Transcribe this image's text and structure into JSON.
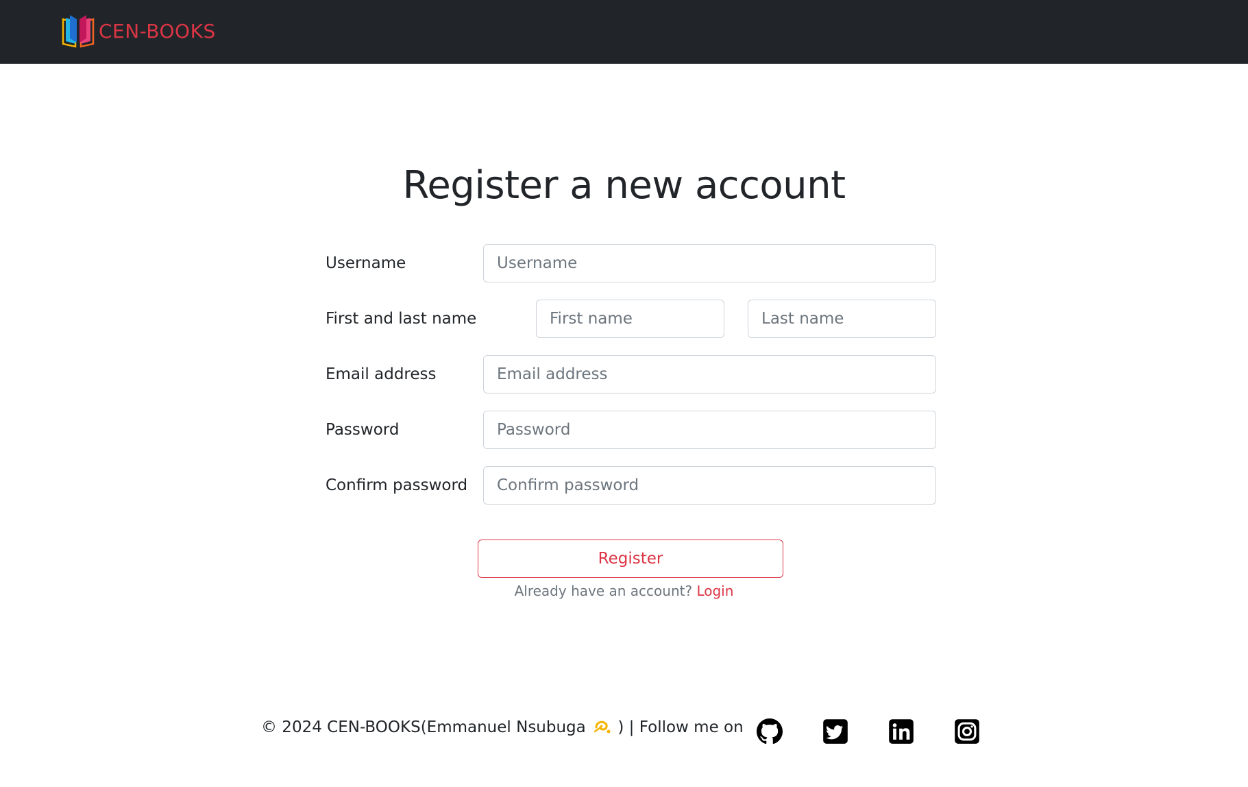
{
  "navbar": {
    "brand": "CEN-BOOKS"
  },
  "page": {
    "title": "Register a new account"
  },
  "form": {
    "username": {
      "label": "Username",
      "placeholder": "Username",
      "value": ""
    },
    "name": {
      "label": "First and last name",
      "first_placeholder": "First name",
      "last_placeholder": "Last name"
    },
    "email": {
      "label": "Email address",
      "placeholder": "Email address"
    },
    "password": {
      "label": "Password",
      "placeholder": "Password"
    },
    "confirm": {
      "label": "Confirm password",
      "placeholder": "Confirm password"
    },
    "submit_label": "Register",
    "login_prompt": "Already have an account?",
    "login_link": "Login"
  },
  "footer": {
    "text_before": "© 2024 CEN-BOOKS(Emmanuel Nsubuga",
    "text_after": ") | Follow me on",
    "social": [
      "github-icon",
      "twitter-icon",
      "linkedin-icon",
      "instagram-icon"
    ]
  },
  "colors": {
    "navbar_bg": "#212529",
    "accent": "#dc3545",
    "muted": "#6c757d",
    "input_border": "#ced4da"
  }
}
